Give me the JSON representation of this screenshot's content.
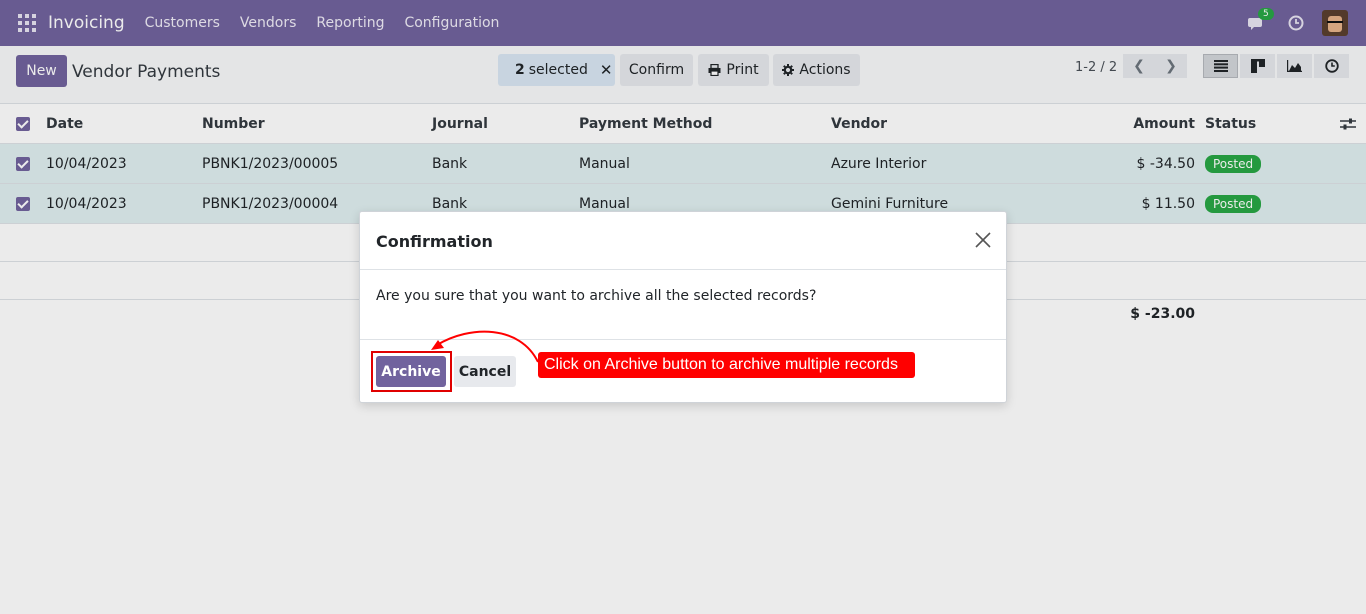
{
  "navbar": {
    "app_name": "Invoicing",
    "menu": [
      "Customers",
      "Vendors",
      "Reporting",
      "Configuration"
    ],
    "chat_count": "5",
    "accent": "#71639e"
  },
  "control": {
    "new_label": "New",
    "title": "Vendor Payments",
    "selected_count": "2",
    "selected_label": "selected",
    "confirm_label": "Confirm",
    "print_label": "Print",
    "actions_label": "Actions",
    "pager": "1-2 / 2"
  },
  "table": {
    "headers": {
      "date": "Date",
      "number": "Number",
      "journal": "Journal",
      "method": "Payment Method",
      "vendor": "Vendor",
      "amount": "Amount",
      "status": "Status"
    },
    "rows": [
      {
        "date": "10/04/2023",
        "number": "PBNK1/2023/00005",
        "journal": "Bank",
        "method": "Manual",
        "vendor": "Azure Interior",
        "amount": "$ -34.50",
        "status": "Posted"
      },
      {
        "date": "10/04/2023",
        "number": "PBNK1/2023/00004",
        "journal": "Bank",
        "method": "Manual",
        "vendor": "Gemini Furniture",
        "amount": "$ 11.50",
        "status": "Posted"
      }
    ],
    "total": "$ -23.00"
  },
  "modal": {
    "title": "Confirmation",
    "body": "Are you sure that you want to archive all the selected records?",
    "archive_label": "Archive",
    "cancel_label": "Cancel"
  },
  "annotation": {
    "text": "Click on Archive button to archive multiple records",
    "color": "#ff0000"
  }
}
